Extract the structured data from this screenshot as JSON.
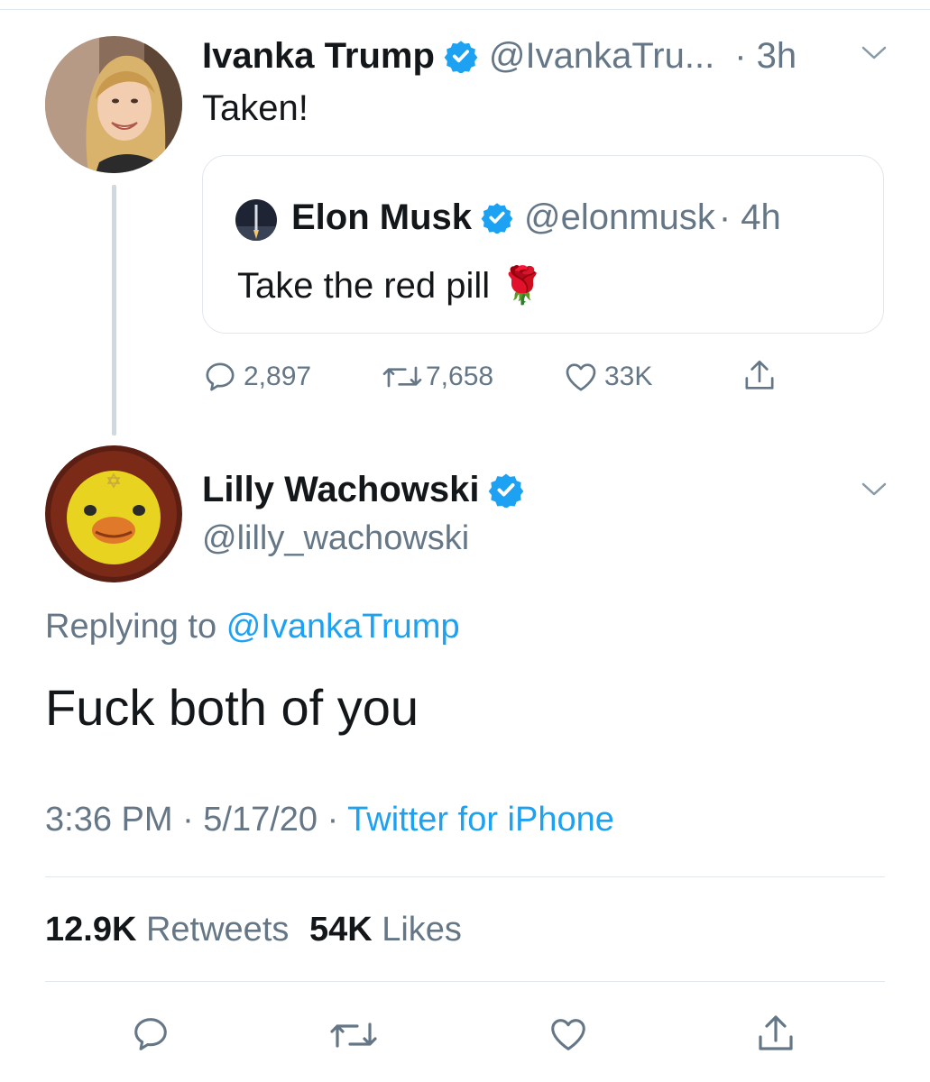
{
  "colors": {
    "accent": "#1da1f2",
    "text": "#14171a",
    "secondary": "#657786",
    "border": "#e1e8ed"
  },
  "parent_tweet": {
    "author_name": "Ivanka Trump",
    "author_handle": "@IvankaTru...",
    "time": "· 3h",
    "text": "Taken!",
    "quoted_tweet": {
      "author_name": "Elon Musk",
      "author_handle": "@elonmusk",
      "time": "· 4h",
      "text": "Take the red pill 🌹"
    },
    "actions": {
      "replies": "2,897",
      "retweets": "7,658",
      "likes": "33K"
    },
    "icons": [
      "reply-icon",
      "retweet-icon",
      "like-icon",
      "share-icon",
      "chevron-down-icon",
      "verified-badge-icon"
    ]
  },
  "main_tweet": {
    "author_name": "Lilly Wachowski",
    "author_handle": "@lilly_wachowski",
    "replying_prefix": "Replying to",
    "replying_handle": "@IvankaTrump",
    "text": "Fuck both of you",
    "timestamp": "3:36 PM · 5/17/20 ·",
    "source": "Twitter for iPhone",
    "stats": {
      "retweets_count": "12.9K",
      "retweets_label": "Retweets",
      "likes_count": "54K",
      "likes_label": "Likes"
    },
    "action_icons": [
      "reply-icon",
      "retweet-icon",
      "like-icon",
      "share-icon"
    ]
  }
}
